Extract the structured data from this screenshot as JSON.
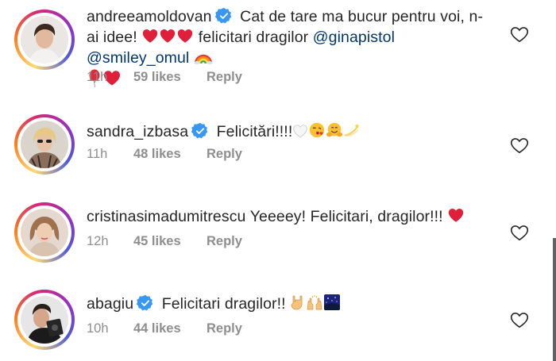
{
  "comments": [
    {
      "username": "andreeamoldovan",
      "text_a": "Cat de tare ma bucur pentru voi, n-ai",
      "text_b": "idee!",
      "text_c": "felicitari dragilor",
      "mention1": "@ginapistol",
      "mention2": "@smiley_omul",
      "time": "11h",
      "likes": "59 likes",
      "reply": "Reply"
    },
    {
      "username": "sandra_izbasa",
      "text": "Felicitări!!!!",
      "time": "11h",
      "likes": "48 likes",
      "reply": "Reply"
    },
    {
      "username": "cristinasimadumitrescu",
      "text": "Yeeeey! Felicitari, dragilor!!!",
      "time": "12h",
      "likes": "45 likes",
      "reply": "Reply"
    },
    {
      "username": "abagiu",
      "text": "Felicitari dragilor!!",
      "time": "10h",
      "likes": "44 likes",
      "reply": "Reply"
    }
  ],
  "colors": {
    "verified": "#3897f0",
    "mention": "#00376b",
    "meta": "#8e8e8e",
    "heart_red": "#ed4956"
  },
  "icons": [
    "verified-badge-icon",
    "heart-outline-icon",
    "red-heart-emoji",
    "rainbow-emoji",
    "balloon-emoji",
    "white-heart-emoji",
    "kiss-emoji",
    "hugging-emoji",
    "dizzy-emoji",
    "rock-hand-emoji",
    "raised-hands-emoji",
    "night-sky-emoji"
  ]
}
